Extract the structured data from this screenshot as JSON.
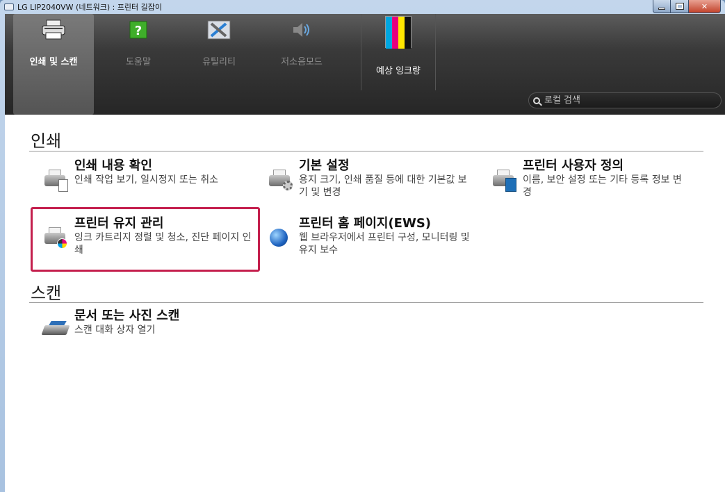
{
  "window": {
    "title": "LG LIP2040VW (네트워크) : 프린터 길잡이"
  },
  "toolbar": {
    "tabs": [
      {
        "label": "인쇄 및 스캔",
        "icon": "printer-icon"
      },
      {
        "label": "도움말",
        "icon": "help-icon"
      },
      {
        "label": "유틸리티",
        "icon": "tools-icon"
      },
      {
        "label": "저소음모드",
        "icon": "speaker-icon"
      }
    ],
    "ink": {
      "label": "예상 잉크량",
      "colors": [
        "#00a7e1",
        "#e6007e",
        "#ffe600",
        "#111111"
      ]
    },
    "search": {
      "placeholder": "로컬 검색"
    }
  },
  "sections": {
    "print": {
      "title": "인쇄",
      "items": [
        {
          "title": "인쇄 내용 확인",
          "desc": "인쇄 작업 보기, 일시정지 또는 취소"
        },
        {
          "title": "기본 설정",
          "desc": "용지 크기, 인쇄 품질 등에 대한 기본값 보기 및 변경"
        },
        {
          "title": "프린터 사용자 정의",
          "desc": "이름, 보안 설정 또는 기타 등록 정보 변경"
        },
        {
          "title": "프린터 유지 관리",
          "desc": "잉크 카트리지 정렬 및 청소, 진단 페이지 인쇄"
        },
        {
          "title": "프린터 홈 페이지(EWS)",
          "desc": "웹 브라우저에서 프린터 구성, 모니터링 및 유지 보수"
        }
      ]
    },
    "scan": {
      "title": "스캔",
      "items": [
        {
          "title": "문서 또는 사진 스캔",
          "desc": "스캔 대화 상자 열기"
        }
      ]
    }
  },
  "colors": {
    "highlight": "#c41f4d"
  }
}
